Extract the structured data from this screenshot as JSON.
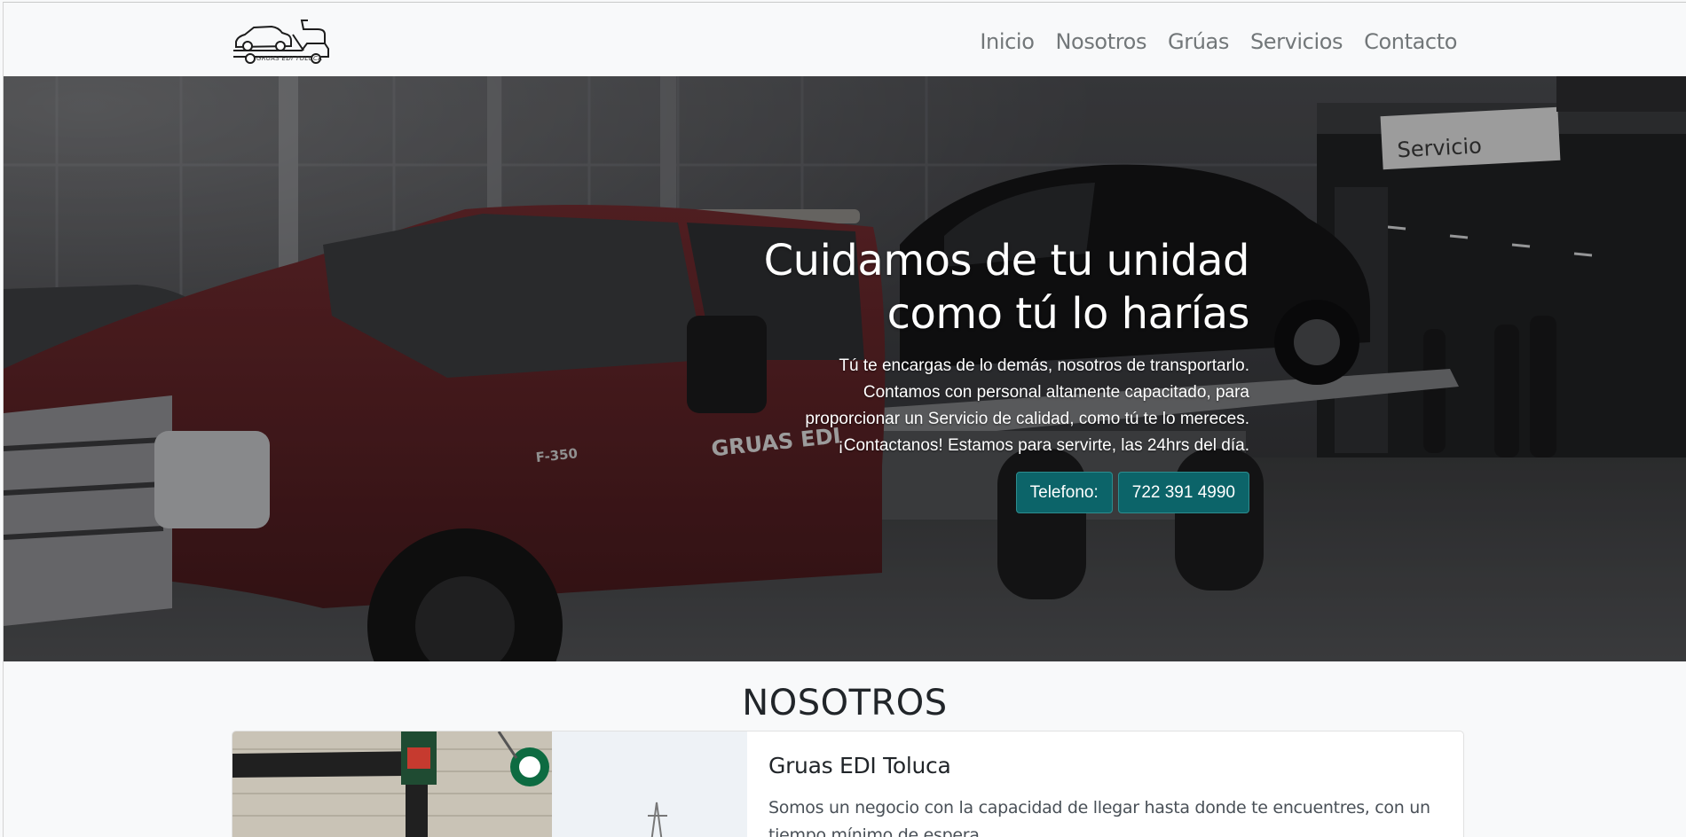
{
  "brand": {
    "name": "Gruas EDI Toluca",
    "caption": "GRUAS EDI TOLUCA",
    "logo_icon": "tow-truck-icon"
  },
  "nav": {
    "items": [
      {
        "label": "Inicio"
      },
      {
        "label": "Nosotros"
      },
      {
        "label": "Grúas"
      },
      {
        "label": "Servicios"
      },
      {
        "label": "Contacto"
      }
    ]
  },
  "hero": {
    "title_line1": "Cuidamos de tu unidad",
    "title_line2": "como tú lo harías",
    "lead_lines": [
      "Tú te encargas de lo demás, nosotros de transportarlo.",
      "Contamos con personal altamente capacitado, para",
      "proporcionar un Servicio de calidad, como tú te lo mereces.",
      "¡Contactanos! Estamos para servirte, las 24hrs del día."
    ],
    "phone_label": "Telefono:",
    "phone_number": "722 391 4990",
    "sign_text": "Servicio",
    "truck_text": "GRUAS EDI",
    "truck_model": "F-350",
    "brand_color": "#0c6469"
  },
  "nosotros": {
    "heading": "NOSOTROS",
    "card_title": "Gruas EDI Toluca",
    "card_text": "Somos un negocio con la capacidad de llegar hasta donde te encuentres, con un tiempo mínimo de espera."
  }
}
